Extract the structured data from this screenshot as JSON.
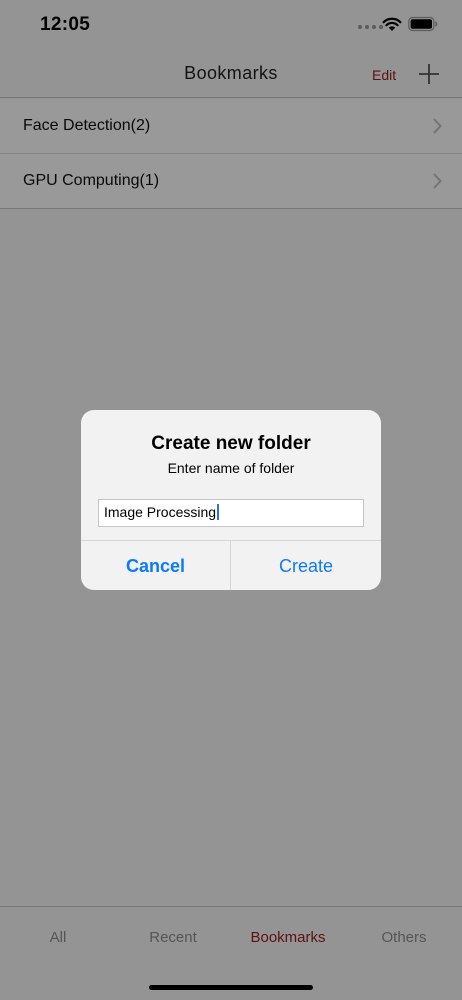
{
  "status_bar": {
    "time": "12:05"
  },
  "nav": {
    "title": "Bookmarks",
    "edit_label": "Edit"
  },
  "bookmarks": [
    {
      "label": "Face Detection(2)"
    },
    {
      "label": "GPU Computing(1)"
    }
  ],
  "dialog": {
    "title": "Create new folder",
    "message": "Enter name of folder",
    "input_value": "Image Processing",
    "cancel_label": "Cancel",
    "create_label": "Create"
  },
  "tabs": [
    {
      "label": "All",
      "active": false
    },
    {
      "label": "Recent",
      "active": false
    },
    {
      "label": "Bookmarks",
      "active": true
    },
    {
      "label": "Others",
      "active": false
    }
  ],
  "colors": {
    "accent": "#9b1c1c",
    "ios_blue": "#0a7aff"
  }
}
